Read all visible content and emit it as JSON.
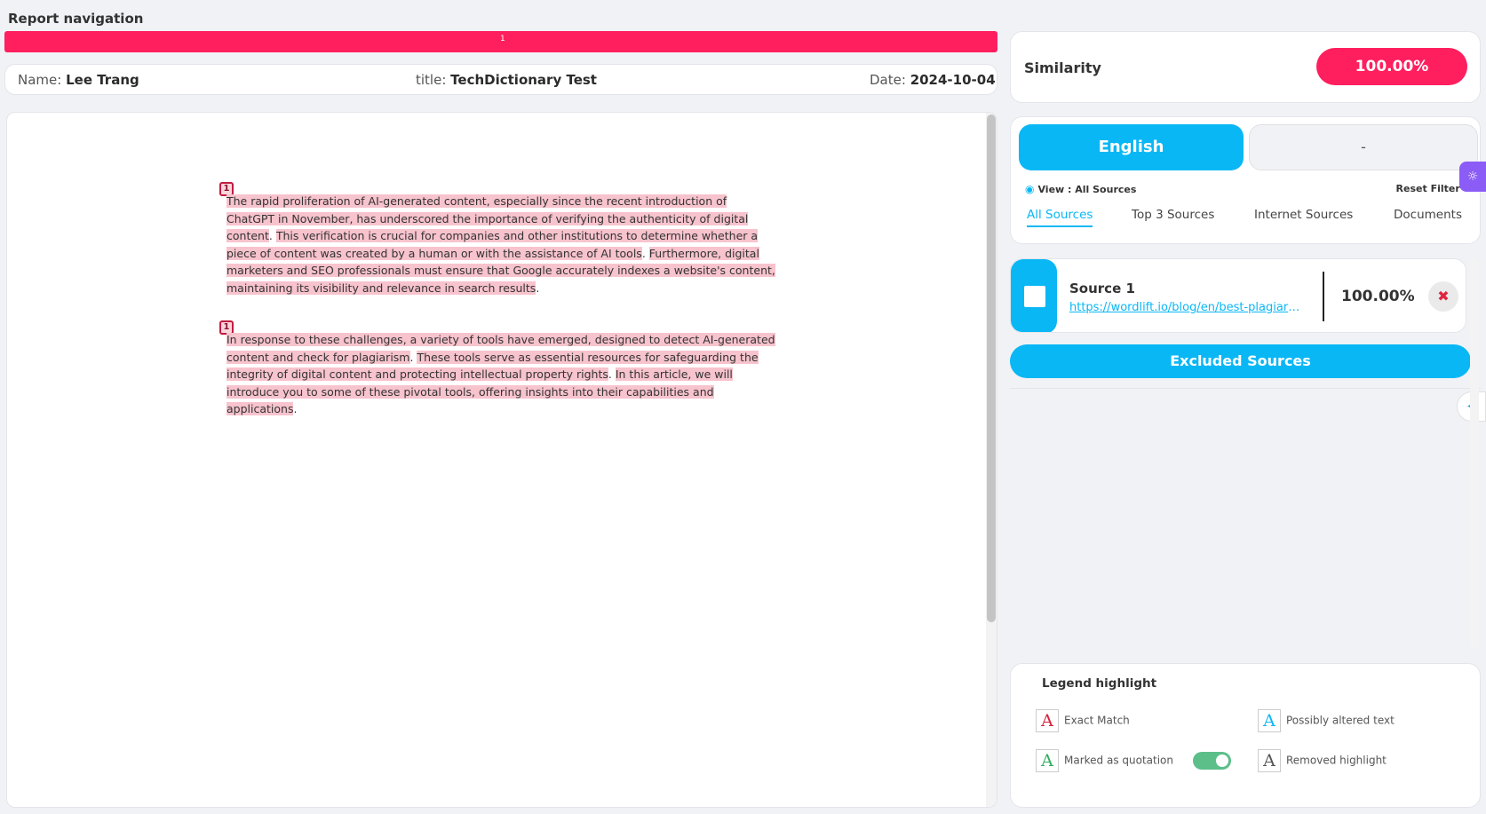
{
  "header": {
    "title": "Report navigation",
    "nav_segment": "1"
  },
  "info": {
    "name_label": "Name:",
    "name_value": "Lee Trang",
    "title_label": "title:",
    "title_value": "TechDictionary Test",
    "date_label": "Date:",
    "date_value": "2024-10-04"
  },
  "document": {
    "paragraphs": [
      {
        "tag": "1",
        "segments": [
          {
            "text": "The rapid proliferation of AI-generated content, especially since the recent introduction of ChatGPT in November, has underscored the importance of verifying the authenticity of digital content",
            "hl": true
          },
          {
            "text": ". ",
            "hl": false
          },
          {
            "text": "This verification is crucial for companies and other institutions to determine whether a piece of content was created by a human or with the assistance of AI tools",
            "hl": true
          },
          {
            "text": ". ",
            "hl": false
          },
          {
            "text": "Furthermore, digital marketers and SEO professionals must ensure that Google accurately indexes a website's content, maintaining its visibility and relevance in search results",
            "hl": true
          },
          {
            "text": ".",
            "hl": false
          }
        ]
      },
      {
        "tag": "1",
        "segments": [
          {
            "text": "In response to these challenges, a variety of tools have emerged, designed to detect AI-generated content and check for plagiarism",
            "hl": true
          },
          {
            "text": ". ",
            "hl": false
          },
          {
            "text": "These tools serve as essential resources for safeguarding the integrity of digital content and protecting intellectual property rights",
            "hl": true
          },
          {
            "text": ". ",
            "hl": false
          },
          {
            "text": "In this article, we will introduce you to some of these pivotal tools, offering insights into their capabilities and applications",
            "hl": true
          },
          {
            "text": ".",
            "hl": false
          }
        ]
      }
    ]
  },
  "similarity": {
    "label": "Similarity",
    "value": "100.00%"
  },
  "language": {
    "primary": "English",
    "secondary": "-"
  },
  "filter": {
    "view_label": "View : All Sources",
    "reset_label": "Reset Filter"
  },
  "tabs": [
    "All Sources",
    "Top 3 Sources",
    "Internet Sources",
    "Documents"
  ],
  "sources": [
    {
      "name": "Source 1",
      "url": "https://wordlift.io/blog/en/best-plagiarism-checker-ai-content-detector/",
      "percent": "100.00%",
      "color": "#0ab7f5"
    }
  ],
  "excluded_label": "Excluded Sources",
  "legend": {
    "title": "Legend highlight",
    "letter": "A",
    "items": [
      {
        "label": "Exact Match",
        "color": "#d8223c"
      },
      {
        "label": "Possibly altered text",
        "color": "#0ab7f5"
      },
      {
        "label": "Marked as quotation",
        "color": "#2fae5e"
      },
      {
        "label": "Removed highlight",
        "color": "#555555"
      }
    ]
  },
  "colors": {
    "accent_pink": "#ff1f5e",
    "accent_cyan": "#0ab7f5",
    "highlight": "#f7c3cd"
  }
}
